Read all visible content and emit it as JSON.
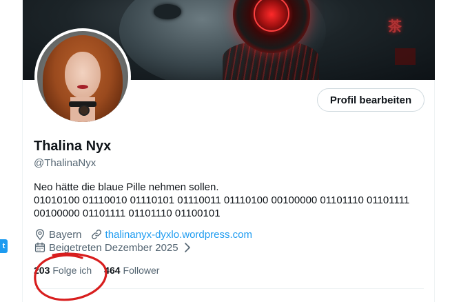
{
  "sidebar": {
    "badge_text": "t"
  },
  "profile": {
    "display_name": "Thalina Nyx",
    "handle": "@ThalinaNyx",
    "bio_line1": "Neo hätte die blaue Pille nehmen sollen.",
    "bio_line2": "01010100 01110010 01110101 01110011 01110100 00100000 01101110 01101111",
    "bio_line3": "00100000 01101111 01101110 01100101",
    "location": "Bayern",
    "website": "thalinanyx-dyxlo.wordpress.com",
    "joined": "Beigetreten Dezember 2025",
    "edit_button_label": "Profil bearbeiten"
  },
  "stats": {
    "following_count": "203",
    "following_label": "Folge ich",
    "followers_count": "464",
    "followers_label": "Follower"
  },
  "banner": {
    "sign_text": "茶"
  },
  "colors": {
    "accent": "#1d9bf0",
    "text_primary": "#0f1419",
    "text_secondary": "#536471",
    "annotation": "#d81e1e"
  },
  "icons": {
    "location": "location-pin-icon",
    "website": "link-icon",
    "joined": "calendar-icon",
    "joined_chevron": "chevron-right-icon"
  }
}
